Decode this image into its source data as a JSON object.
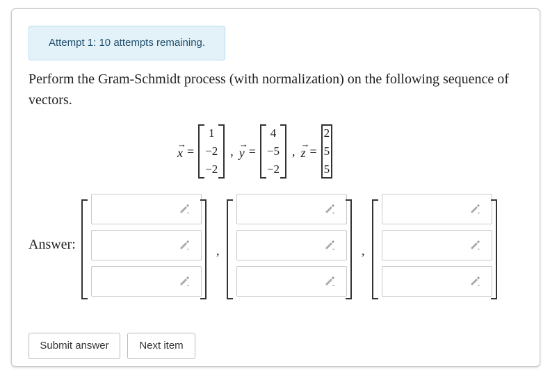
{
  "alert": {
    "text": "Attempt 1: 10 attempts remaining."
  },
  "prompt": {
    "text": "Perform the Gram-Schmidt process (with normalization) on the following sequence of vectors."
  },
  "vectors": [
    {
      "name": "x",
      "entries": [
        "1",
        "−2",
        "−2"
      ]
    },
    {
      "name": "y",
      "entries": [
        "4",
        "−5",
        "−2"
      ]
    },
    {
      "name": "z",
      "entries": [
        "2",
        "5",
        "5"
      ]
    }
  ],
  "symbols": {
    "equals": "=",
    "comma": ","
  },
  "answer": {
    "label": "Answer:",
    "vectors": [
      {
        "fields": [
          {
            "value": "",
            "placeholder": ""
          },
          {
            "value": "",
            "placeholder": ""
          },
          {
            "value": "",
            "placeholder": ""
          }
        ]
      },
      {
        "fields": [
          {
            "value": "",
            "placeholder": ""
          },
          {
            "value": "",
            "placeholder": ""
          },
          {
            "value": "",
            "placeholder": ""
          }
        ]
      },
      {
        "fields": [
          {
            "value": "",
            "placeholder": ""
          },
          {
            "value": "",
            "placeholder": ""
          },
          {
            "value": "",
            "placeholder": ""
          }
        ]
      }
    ]
  },
  "buttons": {
    "submit": "Submit answer",
    "next": "Next item"
  },
  "icons": {
    "field_icon": "pencil-icon"
  }
}
